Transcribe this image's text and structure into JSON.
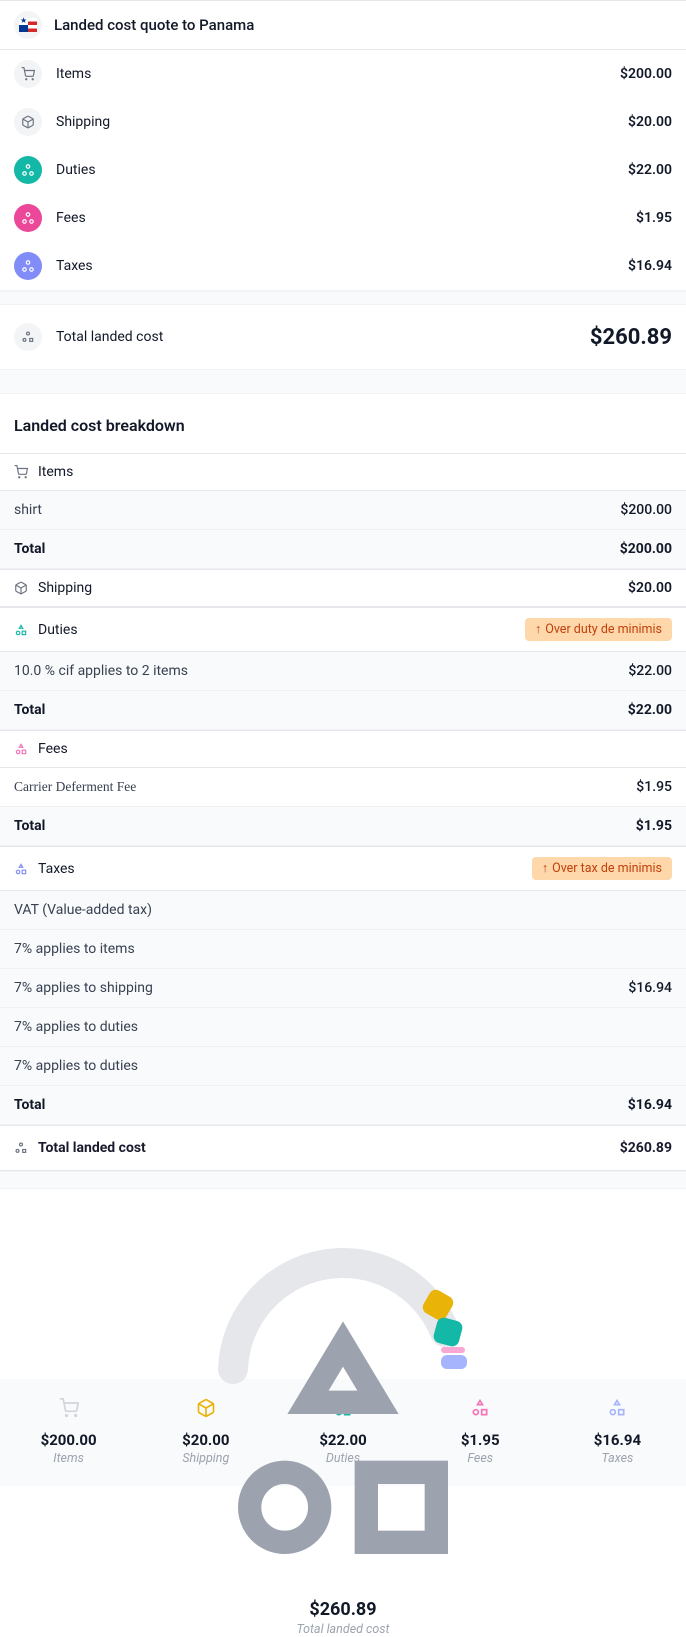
{
  "header": {
    "title": "Landed cost quote to Panama"
  },
  "summary": {
    "items": {
      "label": "Items",
      "amount": "$200.00"
    },
    "shipping": {
      "label": "Shipping",
      "amount": "$20.00"
    },
    "duties": {
      "label": "Duties",
      "amount": "$22.00"
    },
    "fees": {
      "label": "Fees",
      "amount": "$1.95"
    },
    "taxes": {
      "label": "Taxes",
      "amount": "$16.94"
    },
    "total": {
      "label": "Total landed cost",
      "amount": "$260.89"
    }
  },
  "breakdown": {
    "title": "Landed cost breakdown",
    "items": {
      "header": "Items",
      "rows": [
        {
          "label": "shirt",
          "amount": "$200.00"
        }
      ],
      "total_label": "Total",
      "total_amount": "$200.00"
    },
    "shipping": {
      "header": "Shipping",
      "amount": "$20.00"
    },
    "duties": {
      "header": "Duties",
      "badge": "Over duty de minimis",
      "rows": [
        {
          "label": "10.0 % cif applies to 2 items",
          "amount": "$22.00"
        }
      ],
      "total_label": "Total",
      "total_amount": "$22.00"
    },
    "fees": {
      "header": "Fees",
      "rows": [
        {
          "label": "Carrier Deferment Fee",
          "amount": "$1.95"
        }
      ],
      "total_label": "Total",
      "total_amount": "$1.95"
    },
    "taxes": {
      "header": "Taxes",
      "badge": "Over tax de minimis",
      "rows": [
        {
          "label": "VAT (Value-added tax)",
          "amount": ""
        },
        {
          "label": "7% applies to items",
          "amount": ""
        },
        {
          "label": "7% applies to shipping",
          "amount": "$16.94"
        },
        {
          "label": "7% applies to duties",
          "amount": ""
        },
        {
          "label": "7% applies to duties",
          "amount": ""
        }
      ],
      "total_label": "Total",
      "total_amount": "$16.94"
    },
    "final": {
      "label": "Total landed cost",
      "amount": "$260.89"
    }
  },
  "gauge": {
    "amount": "$260.89",
    "sub": "Total landed cost"
  },
  "footer": {
    "items": {
      "amount": "$200.00",
      "label": "Items"
    },
    "shipping": {
      "amount": "$20.00",
      "label": "Shipping"
    },
    "duties": {
      "amount": "$22.00",
      "label": "Duties"
    },
    "fees": {
      "amount": "$1.95",
      "label": "Fees"
    },
    "taxes": {
      "amount": "$16.94",
      "label": "Taxes"
    }
  },
  "chart_data": {
    "type": "pie",
    "title": "Total landed cost",
    "series": [
      {
        "name": "Items",
        "value": 200.0,
        "color": "#e5e7eb"
      },
      {
        "name": "Shipping",
        "value": 20.0,
        "color": "#eab308"
      },
      {
        "name": "Duties",
        "value": 22.0,
        "color": "#14b8a6"
      },
      {
        "name": "Fees",
        "value": 1.95,
        "color": "#ec4899"
      },
      {
        "name": "Taxes",
        "value": 16.94,
        "color": "#818cf8"
      }
    ],
    "total": 260.89
  }
}
